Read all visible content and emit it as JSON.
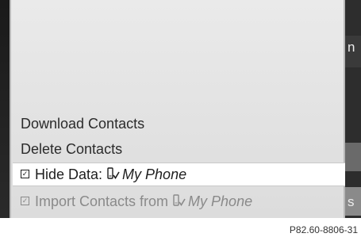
{
  "menu": {
    "items": [
      {
        "label": "Download Contacts"
      },
      {
        "label": "Delete Contacts"
      },
      {
        "label": "Hide Data:",
        "device": "My Phone",
        "checkbox": "checked",
        "icon": "phone-check-icon"
      },
      {
        "label": "Import Contacts from",
        "device": "My Phone",
        "checkbox": "checked",
        "icon": "phone-check-icon"
      }
    ]
  },
  "background": {
    "edge_chars": [
      "n",
      "s"
    ]
  },
  "caption": "P82.60-8806-31",
  "colors": {
    "panel": "#e4e4e4",
    "selected": "#ffffff",
    "text": "#2b2b2b",
    "disabled_text": "#8a8a8a"
  }
}
